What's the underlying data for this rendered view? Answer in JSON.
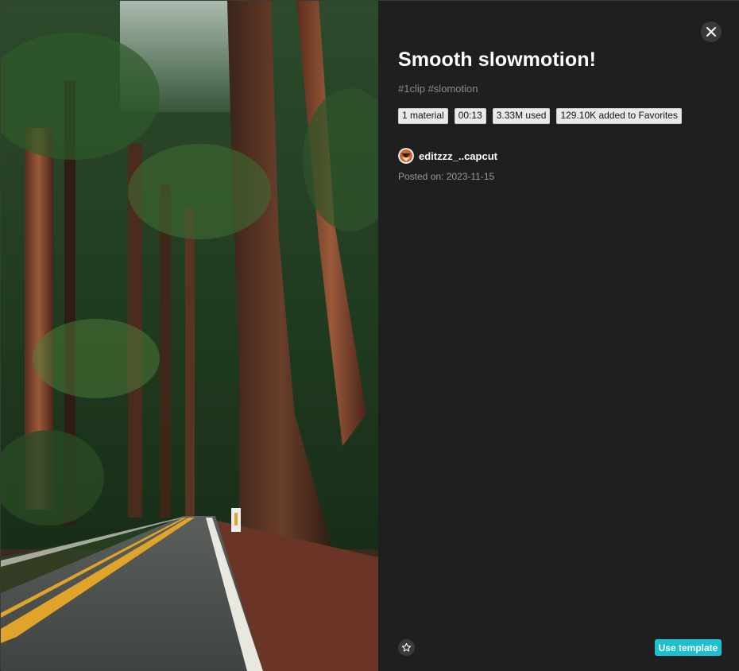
{
  "template": {
    "title": "Smooth slowmotion!",
    "tags": "#1clip #slomotion",
    "badges": {
      "materials": "1 material",
      "duration": "00:13",
      "used": "3.33M used",
      "favorites": "129.10K added to Favorites"
    },
    "author": {
      "name": "editzzz_..capcut",
      "avatar_icon": "avatar-icon"
    },
    "posted_on": "Posted on: 2023-11-15"
  },
  "actions": {
    "use_template_label": "Use template",
    "favorite_icon": "star-icon",
    "close_icon": "close-icon"
  },
  "colors": {
    "panel_bg": "#1f1f1f",
    "accent": "#1cc0cf",
    "badge_bg": "#e9e9e9",
    "muted_text": "#8c8c8c"
  }
}
